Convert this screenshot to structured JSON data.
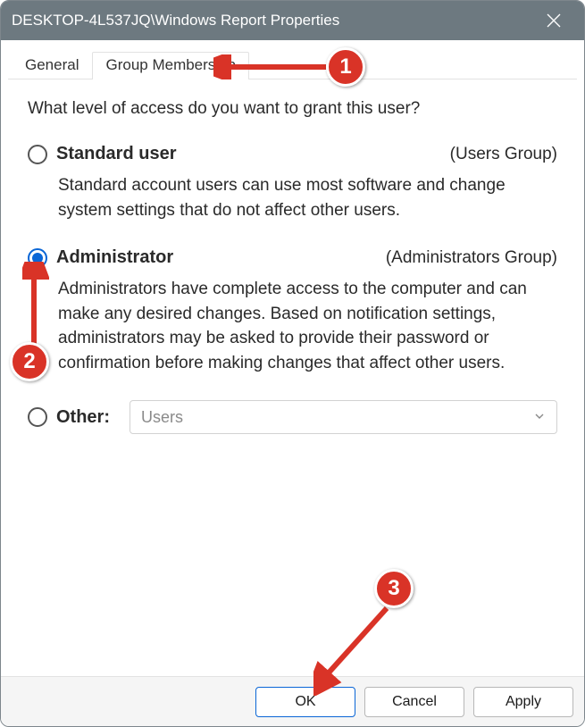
{
  "window": {
    "title": "DESKTOP-4L537JQ\\Windows Report Properties"
  },
  "tabs": {
    "general": "General",
    "group_membership": "Group Membership",
    "active": "group_membership"
  },
  "content": {
    "prompt": "What level of access do you want to grant this user?",
    "standard": {
      "label": "Standard user",
      "group": "(Users Group)",
      "desc": "Standard account users can use most software and change system settings that do not affect other users."
    },
    "admin": {
      "label": "Administrator",
      "group": "(Administrators Group)",
      "desc": "Administrators have complete access to the computer and can make any desired changes. Based on notification settings, administrators may be asked to provide their password or confirmation before making changes that affect other users."
    },
    "other": {
      "label": "Other:",
      "value": "Users"
    },
    "selected": "admin"
  },
  "buttons": {
    "ok": "OK",
    "cancel": "Cancel",
    "apply": "Apply"
  },
  "annotations": {
    "badge1": "1",
    "badge2": "2",
    "badge3": "3"
  },
  "colors": {
    "accent": "#0a66d6",
    "annotation": "#d93327",
    "titlebar": "#6d7980"
  }
}
